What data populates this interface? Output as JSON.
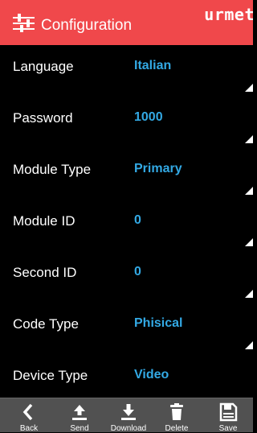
{
  "header": {
    "title": "Configuration",
    "brand": "urmet",
    "icon": "sliders-icon",
    "color": "#f0484b"
  },
  "rows": [
    {
      "label": "Language",
      "value": "Italian"
    },
    {
      "label": "Password",
      "value": "1000"
    },
    {
      "label": "Module Type",
      "value": "Primary"
    },
    {
      "label": "Module ID",
      "value": "0"
    },
    {
      "label": "Second ID",
      "value": "0"
    },
    {
      "label": "Code Type",
      "value": "Phisical"
    },
    {
      "label": "Device Type",
      "value": "Video"
    }
  ],
  "value_color": "#33a9e4",
  "toolbar": {
    "back": {
      "label": "Back",
      "icon": "chevron-left-icon"
    },
    "send": {
      "label": "Send",
      "icon": "upload-icon"
    },
    "download": {
      "label": "Download",
      "icon": "download-icon"
    },
    "delete": {
      "label": "Delete",
      "icon": "trash-icon"
    },
    "save": {
      "label": "Save",
      "icon": "floppy-disk-icon"
    }
  }
}
